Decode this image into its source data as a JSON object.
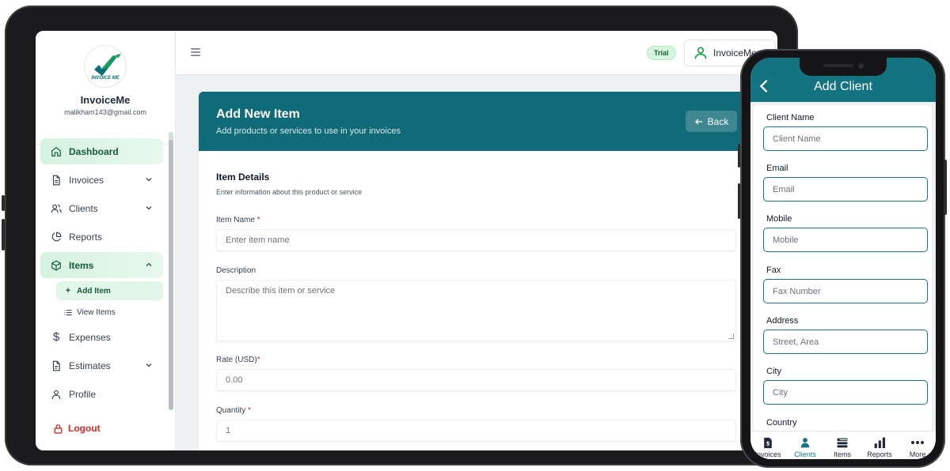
{
  "tablet": {
    "brand": {
      "logo_text": "INVOICE ME",
      "name": "InvoiceMe",
      "email": "malikham143@gmail.com"
    },
    "nav": [
      {
        "label": "Dashboard",
        "icon": "home-icon",
        "active": true
      },
      {
        "label": "Invoices",
        "icon": "file-icon",
        "has_children": true
      },
      {
        "label": "Clients",
        "icon": "users-icon",
        "has_children": true
      },
      {
        "label": "Reports",
        "icon": "pie-chart-icon"
      },
      {
        "label": "Items",
        "icon": "box-icon",
        "active": true,
        "expanded": true
      },
      {
        "label": "Expenses",
        "icon": "dollar-icon"
      },
      {
        "label": "Estimates",
        "icon": "clipboard-icon",
        "has_children": true
      },
      {
        "label": "Profile",
        "icon": "user-icon"
      }
    ],
    "items_sub": [
      {
        "label": "Add Item",
        "icon": "plus-icon",
        "active": true
      },
      {
        "label": "View Items",
        "icon": "list-icon"
      }
    ],
    "logout_label": "Logout",
    "topbar": {
      "badge": "Trial",
      "user_label": "InvoiceMe"
    },
    "form": {
      "title": "Add New Item",
      "subtitle": "Add products or services to use in your invoices",
      "back_label": "Back",
      "section_title": "Item Details",
      "section_subtitle": "Enter information about this product or service",
      "fields": {
        "item_name": {
          "label": "Item Name",
          "required": "*",
          "placeholder": "Enter item name"
        },
        "description": {
          "label": "Description",
          "placeholder": "Describe this item or service"
        },
        "rate": {
          "label": "Rate (USD)",
          "required": "*",
          "placeholder": "0.00"
        },
        "quantity": {
          "label": "Quantity",
          "required": "*",
          "placeholder": "1"
        }
      }
    }
  },
  "phone": {
    "title": "Add Client",
    "fields": [
      {
        "label": "Client Name",
        "placeholder": "Client Name"
      },
      {
        "label": "Email",
        "placeholder": "Email"
      },
      {
        "label": "Mobile",
        "placeholder": "Mobile"
      },
      {
        "label": "Fax",
        "placeholder": "Fax Number"
      },
      {
        "label": "Address",
        "placeholder": "Street, Area"
      },
      {
        "label": "City",
        "placeholder": "City"
      },
      {
        "label": "Country"
      }
    ],
    "tabs": [
      {
        "label": "Invoices",
        "icon": "invoice-icon"
      },
      {
        "label": "Clients",
        "icon": "person-icon",
        "active": true
      },
      {
        "label": "Items",
        "icon": "items-icon"
      },
      {
        "label": "Reports",
        "icon": "bar-chart-icon"
      },
      {
        "label": "More",
        "icon": "more-icon"
      }
    ]
  },
  "colors": {
    "teal": "#106b78",
    "green_active": "#155c33",
    "logout_red": "#dc2626"
  }
}
